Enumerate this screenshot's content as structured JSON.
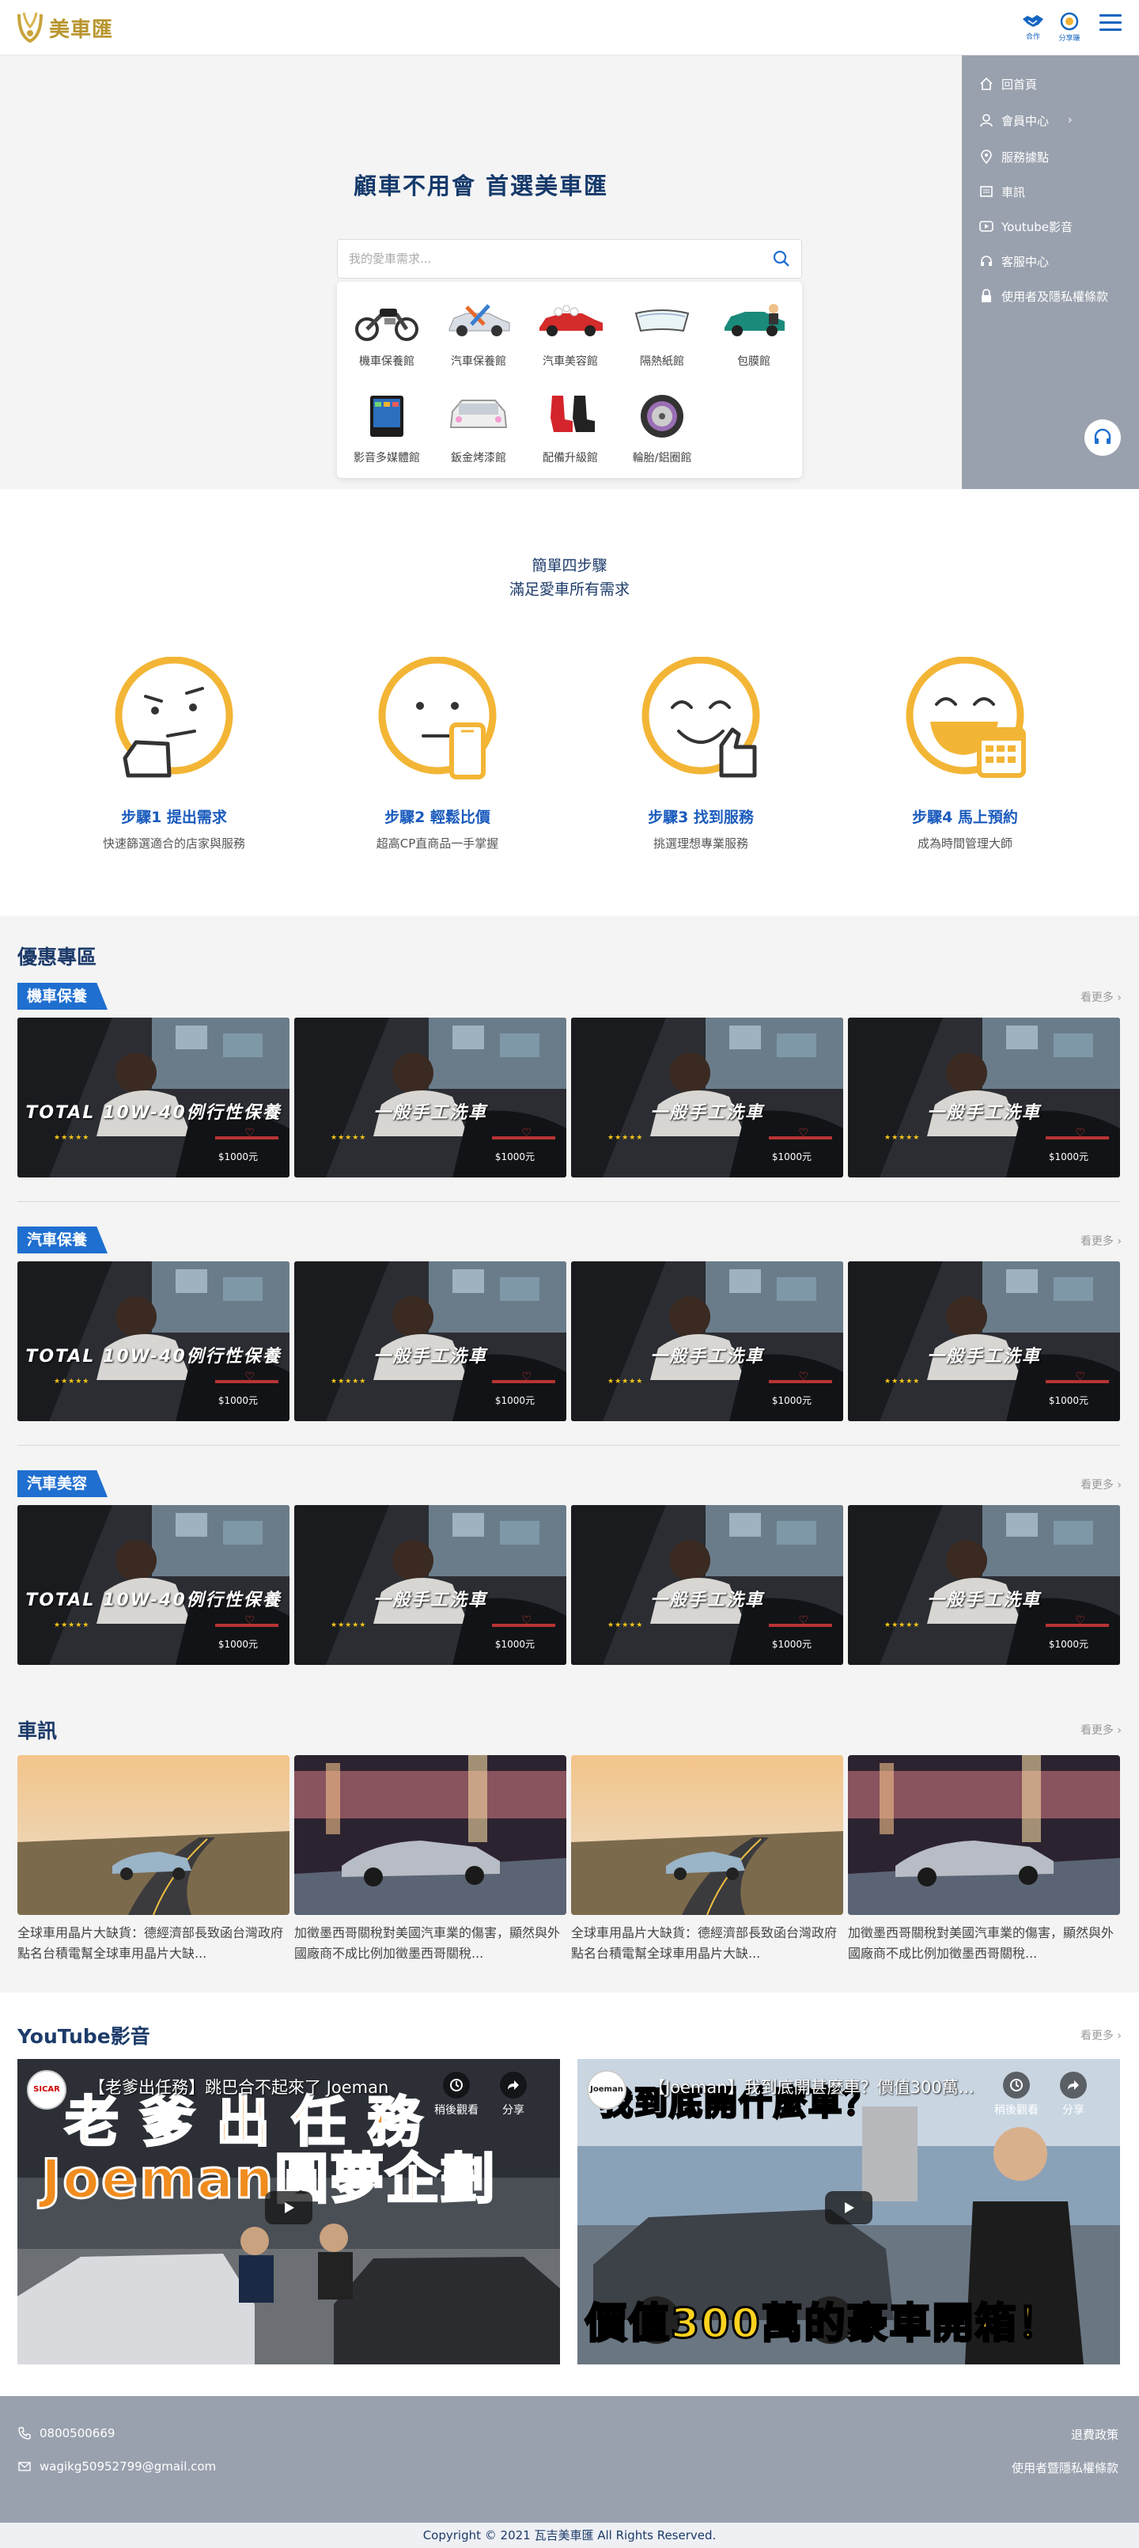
{
  "brand": {
    "name": "美車匯",
    "color": "#b8952e"
  },
  "header": {
    "cooperate_label": "合作",
    "share_label": "分享賺"
  },
  "side_menu": {
    "items": [
      {
        "label": "回首頁",
        "icon": "home-icon"
      },
      {
        "label": "會員中心",
        "icon": "user-icon",
        "chevron": "›"
      },
      {
        "label": "服務據點",
        "icon": "location-pin-icon"
      },
      {
        "label": "車訊",
        "icon": "news-icon"
      },
      {
        "label": "Youtube影音",
        "icon": "play-icon"
      },
      {
        "label": "客服中心",
        "icon": "headset-icon"
      },
      {
        "label": "使用者及隱私權條款",
        "icon": "lock-icon"
      }
    ]
  },
  "hero": {
    "title": "顧車不用會  首選美車匯",
    "search_placeholder": "我的愛車需求...",
    "categories": [
      {
        "label": "機車保養館",
        "icon": "motorcycle-icon"
      },
      {
        "label": "汽車保養館",
        "icon": "car-tools-icon"
      },
      {
        "label": "汽車美容館",
        "icon": "car-wash-icon"
      },
      {
        "label": "隔熱紙館",
        "icon": "windshield-film-icon"
      },
      {
        "label": "包膜館",
        "icon": "car-wrap-icon"
      },
      {
        "label": "影音多媒體館",
        "icon": "multimedia-screen-icon"
      },
      {
        "label": "鈑金烤漆館",
        "icon": "car-body-icon"
      },
      {
        "label": "配備升級館",
        "icon": "car-seat-icon"
      },
      {
        "label": "輪胎/鋁圈館",
        "icon": "wheel-rim-icon"
      }
    ]
  },
  "steps": {
    "title_line1": "簡單四步驟",
    "title_line2": "滿足愛車所有需求",
    "items": [
      {
        "title": "步驟1  提出需求",
        "subtitle": "快速篩選適合的店家與服務",
        "icon": "thinking-face-icon"
      },
      {
        "title": "步驟2  輕鬆比價",
        "subtitle": "超高CP直商品一手掌握",
        "icon": "phone-face-icon"
      },
      {
        "title": "步驟3  找到服務",
        "subtitle": "挑選理想專業服務",
        "icon": "thumbs-up-face-icon"
      },
      {
        "title": "步驟4  馬上預約",
        "subtitle": "成為時間管理大師",
        "icon": "calendar-face-icon"
      }
    ]
  },
  "deals": {
    "title": "優惠專區",
    "more_label": "看更多 ›",
    "groups": [
      {
        "tag": "機車保養",
        "cards": [
          {
            "text": "TOTAL 10W-40例行性保養",
            "price": "$1000元"
          },
          {
            "text": "一般手工洗車",
            "price": "$1000元"
          },
          {
            "text": "一般手工洗車",
            "price": "$1000元"
          },
          {
            "text": "一般手工洗車",
            "price": "$1000元"
          }
        ]
      },
      {
        "tag": "汽車保養",
        "cards": [
          {
            "text": "TOTAL 10W-40例行性保養",
            "price": "$1000元"
          },
          {
            "text": "一般手工洗車",
            "price": "$1000元"
          },
          {
            "text": "一般手工洗車",
            "price": "$1000元"
          },
          {
            "text": "一般手工洗車",
            "price": "$1000元"
          }
        ]
      },
      {
        "tag": "汽車美容",
        "cards": [
          {
            "text": "TOTAL 10W-40例行性保養",
            "price": "$1000元"
          },
          {
            "text": "一般手工洗車",
            "price": "$1000元"
          },
          {
            "text": "一般手工洗車",
            "price": "$1000元"
          },
          {
            "text": "一般手工洗車",
            "price": "$1000元"
          }
        ]
      }
    ]
  },
  "news": {
    "title": "車訊",
    "more_label": "看更多 ›",
    "items": [
      {
        "text": "全球車用晶片大缺貨：德經濟部長致函台灣政府點名台積電幫全球車用晶片大缺..."
      },
      {
        "text": "加徵墨西哥關稅對美國汽車業的傷害，顯然與外國廠商不成比例加徵墨西哥關稅..."
      },
      {
        "text": "全球車用晶片大缺貨：德經濟部長致函台灣政府點名台積電幫全球車用晶片大缺..."
      },
      {
        "text": "加徵墨西哥關稅對美國汽車業的傷害，顯然與外國廠商不成比例加徵墨西哥關稅..."
      }
    ]
  },
  "youtube": {
    "title": "YouTube影音",
    "more_label": "看更多 ›",
    "watch_later": "稍後觀看",
    "share": "分享",
    "videos": [
      {
        "title": "【老爹出任務】跳巴合不起來了 Joeman",
        "channel": "SICAR",
        "headline1": "老 爹 出 任 務",
        "headline2": "Joeman圓夢企劃"
      },
      {
        "title": "【Joeman】我到底開甚麼車？價值300萬...",
        "channel": "Joeman",
        "headline1": "我到底開什麼車？",
        "headline2": "價值300萬的豪車開箱！"
      }
    ]
  },
  "footer": {
    "phone": "0800500669",
    "email": "wagikg50952799@gmail.com",
    "refund_policy": "退費政策",
    "terms": "使用者暨隱私權條款",
    "copyright": "Copyright © 2021 瓦吉美車匯 All Rights Reserved."
  },
  "colors": {
    "primary": "#1f6fd0",
    "navy": "#1d3b6a",
    "gray_panel": "#9aa1ae",
    "gold": "#b8952e",
    "face_yellow": "#f3b535"
  }
}
